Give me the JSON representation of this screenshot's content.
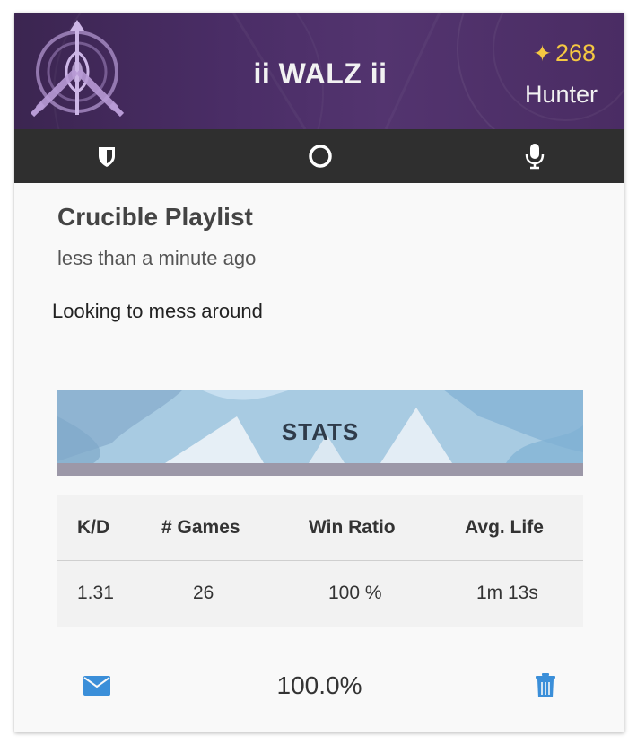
{
  "card": {
    "header": {
      "player_name": "ii WALZ ii",
      "light_level": "268",
      "class_name": "Hunter",
      "emblem_icon": "hunter-emblem",
      "light_icon": "star-icon"
    },
    "icon_bar": {
      "items": [
        {
          "name": "shield-icon"
        },
        {
          "name": "circle-icon"
        },
        {
          "name": "microphone-icon"
        }
      ]
    },
    "activity": {
      "title": "Crucible Playlist",
      "time_posted": "less than a minute ago",
      "message": "Looking to mess around"
    },
    "stats": {
      "banner_label": "STATS",
      "headers": [
        "K/D",
        "# Games",
        "Win Ratio",
        "Avg. Life"
      ],
      "values": [
        "1.31",
        "26",
        "100 %",
        "1m 13s"
      ]
    },
    "footer": {
      "percentage": "100.0%",
      "left_icon": "envelope-icon",
      "right_icon": "trash-icon"
    }
  },
  "colors": {
    "banner": "#4a2d66",
    "icon_bar": "#2f2f2f",
    "light": "#f5c842",
    "action_blue": "#3b8fd9"
  }
}
